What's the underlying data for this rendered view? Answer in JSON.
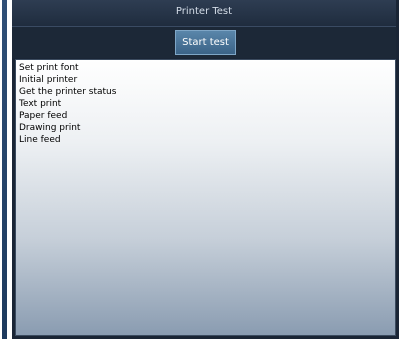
{
  "window": {
    "title": "Printer Test"
  },
  "toolbar": {
    "start_label": "Start test"
  },
  "output": {
    "lines": [
      "Set print font",
      "Initial printer",
      "Get the printer status",
      "Text print",
      "Paper feed",
      "Drawing print",
      "Line feed"
    ]
  }
}
